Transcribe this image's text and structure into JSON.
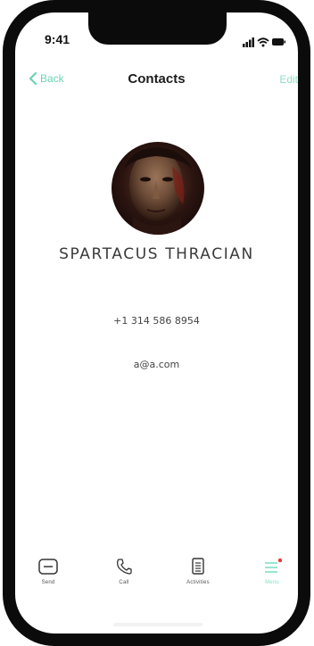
{
  "status_bar": {
    "time": "9:41",
    "icons": [
      "signal-icon",
      "wifi-icon",
      "battery-icon"
    ]
  },
  "nav": {
    "back_label": "Back",
    "title": "Contacts",
    "edit_label": "Edit"
  },
  "contact": {
    "name": "SPARTACUS THRACIAN",
    "phone": "+1 314 586 8954",
    "email": "a@a.com",
    "avatar_icon": "avatar-photo"
  },
  "tabs": [
    {
      "label": "Send",
      "icon": "message-icon",
      "active": false
    },
    {
      "label": "Call",
      "icon": "phone-icon",
      "active": false
    },
    {
      "label": "Activities",
      "icon": "document-icon",
      "active": false
    },
    {
      "label": "Menu",
      "icon": "menu-icon",
      "active": true,
      "badge": true
    }
  ],
  "colors": {
    "accent": "#6bd4b3",
    "badge": "#e53935",
    "frame": "#0b0b0b"
  }
}
